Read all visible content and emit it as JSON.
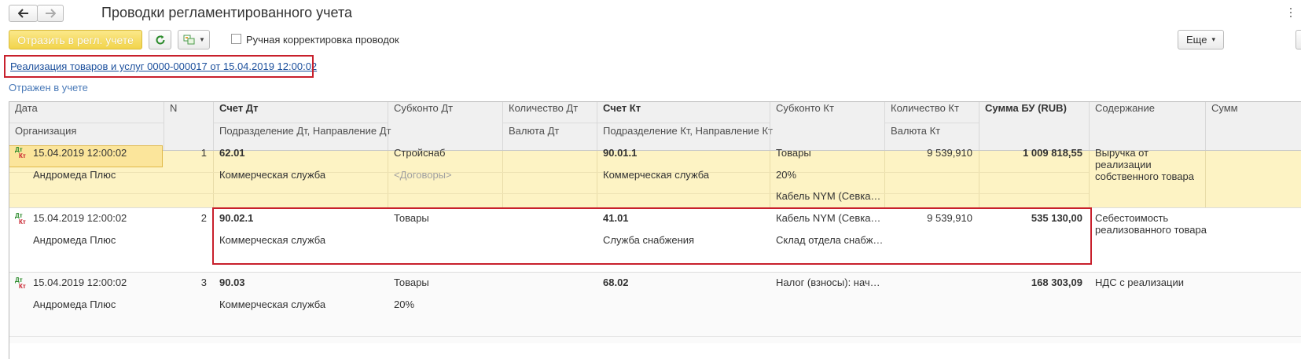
{
  "window": {
    "title": "Проводки регламентированного учета",
    "nav_back_icon": "arrow-left-icon",
    "nav_forward_icon": "arrow-right-icon"
  },
  "toolbar": {
    "post_button": "Отразить в регл. учете",
    "manual_checkbox_label": "Ручная корректировка проводок",
    "manual_checkbox_checked": false,
    "more_button": "Еще",
    "more_chevron": "▾"
  },
  "document": {
    "link": "Реализация товаров и услуг 0000-000017 от 15.04.2019 12:00:02",
    "status": "Отражен в учете"
  },
  "table": {
    "headers": {
      "date": "Дата",
      "org": "Организация",
      "n": "N",
      "acct_dt": "Счет Дт",
      "subdiv_dt": "Подразделение Дт, Направление Дт",
      "subconto_dt": "Субконто Дт",
      "qty_dt": "Количество Дт",
      "cur_dt": "Валюта Дт",
      "acct_kt": "Счет Кт",
      "subdiv_kt": "Подразделение Кт, Направление Кт",
      "subconto_kt": "Субконто Кт",
      "qty_kt": "Количество Кт",
      "cur_kt": "Валюта Кт",
      "sum": "Сумма БУ (RUB)",
      "content": "Содержание",
      "sum2": "Сумм"
    },
    "rows": [
      {
        "date": "15.04.2019 12:00:02",
        "org": "Андромеда Плюс",
        "n": "1",
        "acct_dt": "62.01",
        "subdiv_dt": "Коммерческая служба",
        "subconto_dt_1": "Стройснаб",
        "subconto_dt_2": "<Договоры>",
        "acct_kt": "90.01.1",
        "subdiv_kt": "Коммерческая служба",
        "subconto_kt_1": "Товары",
        "subconto_kt_2": "20%",
        "subconto_kt_3": "Кабель NYM (Севка…",
        "qty_kt": "9 539,910",
        "sum": "1 009 818,55",
        "content_1": "Выручка от",
        "content_2": "реализации",
        "content_3": "собственного товара"
      },
      {
        "date": "15.04.2019 12:00:02",
        "org": "Андромеда Плюс",
        "n": "2",
        "acct_dt": "90.02.1",
        "subdiv_dt": "Коммерческая служба",
        "subconto_dt_1": "Товары",
        "acct_kt": "41.01",
        "subdiv_kt": "Служба снабжения",
        "subconto_kt_1": "Кабель NYM (Севка…",
        "subconto_kt_2": "Склад отдела снабж…",
        "qty_kt": "9 539,910",
        "sum": "535 130,00",
        "content_1": "Себестоимость",
        "content_2": "реализованного товара"
      },
      {
        "date": "15.04.2019 12:00:02",
        "org": "Андромеда Плюс",
        "n": "3",
        "acct_dt": "90.03",
        "subdiv_dt": "Коммерческая служба",
        "subconto_dt_1": "Товары",
        "subconto_dt_2": "20%",
        "acct_kt": "68.02",
        "subconto_kt_1": "Налог (взносы): нач…",
        "sum": "168 303,09",
        "content_1": "НДС с реализации"
      }
    ],
    "entry_icon_dt": "Дт",
    "entry_icon_kt": "Кт"
  },
  "colors": {
    "accent_yellow": "#f2d44b",
    "selected_row": "#fdf3c4",
    "highlight_red": "#c8202c",
    "link_blue": "#1b4f9c"
  }
}
